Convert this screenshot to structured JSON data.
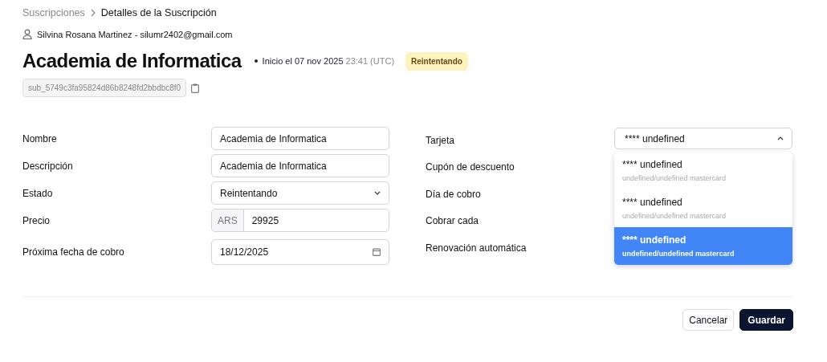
{
  "breadcrumb": [
    {
      "label": "Suscripciones",
      "current": false
    },
    {
      "label": "Detalles de la Suscripción",
      "current": true
    }
  ],
  "customer": "Silvina Rosana Martinez - silumr2402@gmail.com",
  "title": "Academia de Informatica",
  "start": {
    "label": "Inicio el 07 nov 2025",
    "time": "23:41 (UTC)"
  },
  "status_badge": "Reintentando",
  "subscription_id": "sub_5749c3fa95824d86b8248fd2bbdbc8f0",
  "left_fields": [
    {
      "label": "Nombre",
      "kind": "text",
      "value": "Academia de Informatica"
    },
    {
      "label": "Descripción",
      "kind": "text",
      "value": "Academia de Informatica"
    },
    {
      "label": "Estado",
      "kind": "select",
      "value": "Reintentando"
    },
    {
      "label": "Precio",
      "kind": "currency",
      "prefix": "ARS",
      "value": "29925"
    },
    {
      "label": "Próxima fecha de cobro",
      "kind": "date",
      "value": "18/12/2025"
    }
  ],
  "right_fields": [
    {
      "label": "Tarjeta"
    },
    {
      "label": "Cupón de descuento"
    },
    {
      "label": "Día de cobro"
    },
    {
      "label": "Cobrar cada"
    },
    {
      "label": "Renovación automática"
    }
  ],
  "card_select": {
    "value": "**** undefined",
    "expanded": true,
    "options": [
      {
        "title": "**** undefined",
        "subtitle": "undefined/undefined mastercard",
        "highlighted": false
      },
      {
        "title": "**** undefined",
        "subtitle": "undefined/undefined mastercard",
        "highlighted": false
      },
      {
        "title": "**** undefined",
        "subtitle": "undefined/undefined mastercard",
        "highlighted": true
      }
    ]
  },
  "buttons": [
    {
      "label": "Cancelar",
      "kind": "secondary"
    },
    {
      "label": "Guardar",
      "kind": "primary"
    }
  ]
}
